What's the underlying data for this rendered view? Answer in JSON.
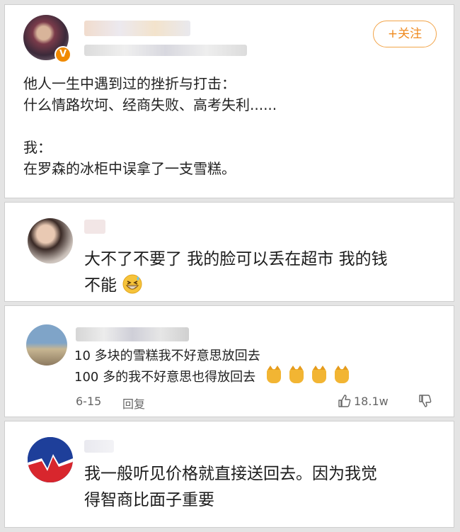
{
  "post": {
    "follow_label": "+关注",
    "lines": [
      "他人一生中遇到过的挫折与打击：",
      "什么情路坎坷、经商失败、高考失利......",
      "",
      "我：",
      "在罗森的冰柜中误拿了一支雪糕。"
    ]
  },
  "reply1": {
    "line1": "大不了不要了 我的脸可以丢在超市 我的钱",
    "line2": "不能",
    "emoji": "grinning-sweat-emoji"
  },
  "reply2": {
    "line1": "10 多块的雪糕我不好意思放回去",
    "line2": "100 多的我不好意思也得放回去",
    "date": "6-15",
    "reply_label": "回复",
    "likes": "18.1w",
    "emoji_count": 4
  },
  "reply3": {
    "line1": "我一般听见价格就直接送回去。因为我觉",
    "line2": "得智商比面子重要"
  },
  "colors": {
    "accent": "#ef8a1f",
    "background": "#e4e4e4",
    "card": "#ffffff",
    "meta_text": "#666666"
  }
}
